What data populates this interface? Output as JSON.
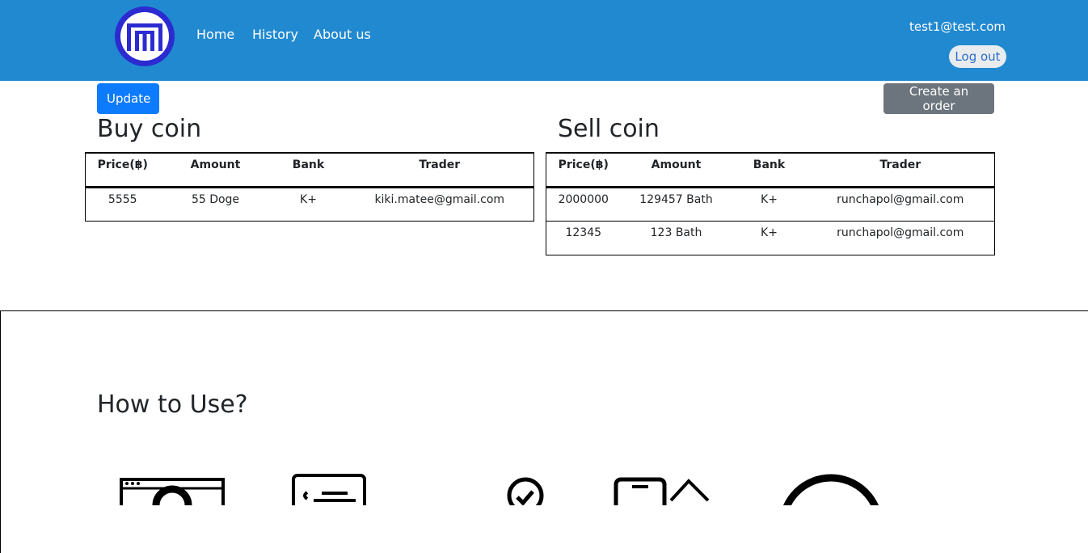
{
  "nav": {
    "links": [
      "Home",
      "History",
      "About us"
    ],
    "user_email": "test1@test.com",
    "logout_label": "Log out"
  },
  "toolbar": {
    "update_label": "Update",
    "create_label": "Create an order"
  },
  "buy": {
    "title": "Buy coin",
    "headers": [
      "Price(฿)",
      "Amount",
      "Bank",
      "Trader"
    ],
    "rows": [
      [
        "5555",
        "55 Doge",
        "K+",
        "kiki.matee@gmail.com"
      ]
    ]
  },
  "sell": {
    "title": "Sell coin",
    "headers": [
      "Price(฿)",
      "Amount",
      "Bank",
      "Trader"
    ],
    "rows": [
      [
        "2000000",
        "129457 Bath",
        "K+",
        "runchapol@gmail.com"
      ],
      [
        "12345",
        "123 Bath",
        "K+",
        "runchapol@gmail.com"
      ]
    ]
  },
  "howto": {
    "title": "How to Use?",
    "icons": [
      "browser-user-icon",
      "form-card-icon",
      "check-circle-icon",
      "phone-transfer-icon",
      "circle-icon"
    ]
  },
  "colors": {
    "navbar": "#2189d0",
    "update_button": "#0d7bfd",
    "create_button": "#6c757d",
    "logo": "#2b2bd1"
  }
}
